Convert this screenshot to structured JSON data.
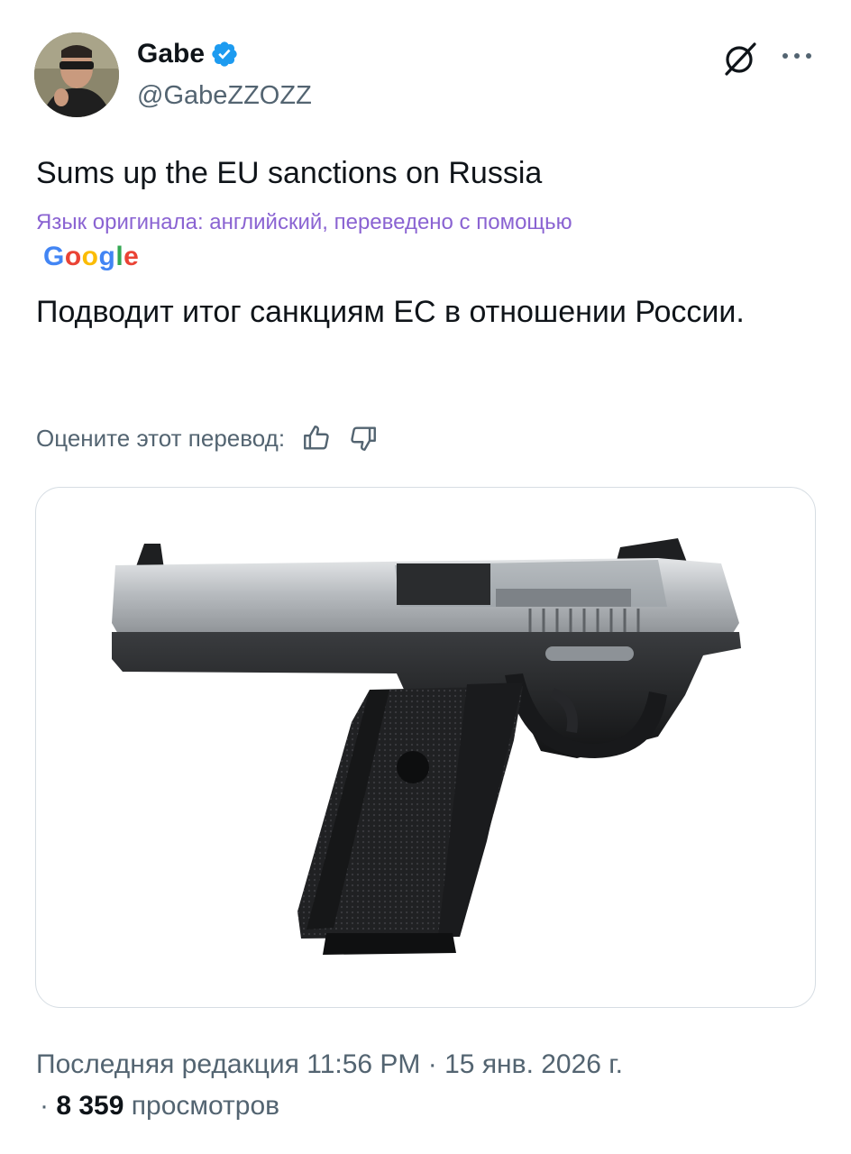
{
  "tweet": {
    "display_name": "Gabe",
    "handle": "@GabeZZOZZ",
    "text": "Sums up the EU sanctions on Russia",
    "translation_note": "Язык оригинала: английский, переведено с помощью",
    "translation_provider": "Google",
    "translated_text": "Подводит итог санкциям ЕС в отношении России.",
    "rate_label": "Оцените этот перевод:",
    "edited_label": "Последняя редакция",
    "time": "11:56 PM",
    "date": "15 янв. 2026 г.",
    "separator": "·",
    "views_count": "8 359",
    "views_label": "просмотров"
  },
  "icons": {
    "verified": "verified-badge-icon",
    "grok": "grok-icon",
    "more": "more-icon",
    "thumbs_up": "thumbs-up-icon",
    "thumbs_down": "thumbs-down-icon"
  },
  "colors": {
    "verified_blue": "#1d9bf0",
    "translation_note": "#8a63d2",
    "secondary_text": "#536471"
  }
}
